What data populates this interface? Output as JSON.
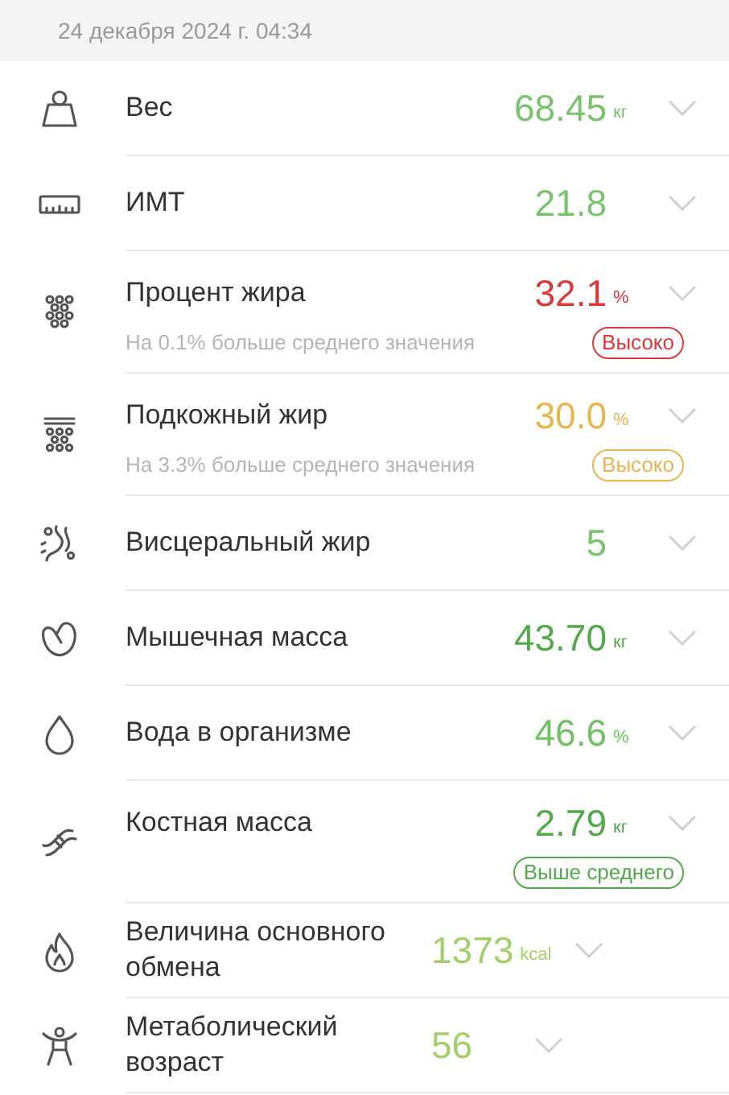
{
  "date": "24 декабря 2024 г. 04:34",
  "metrics": [
    {
      "label": "Вес",
      "value": "68.45",
      "unit": "кг",
      "color": "#79c46a"
    },
    {
      "label": "ИМТ",
      "value": "21.8",
      "color": "#79c46a"
    },
    {
      "label": "Процент жира",
      "value": "32.1",
      "unit": "%",
      "color": "#d9393b",
      "note": "На 0.1% больше среднего значения",
      "badge": "Высоко"
    },
    {
      "label": "Подкожный жир",
      "value": "30.0",
      "unit": "%",
      "color": "#e6b650",
      "note": "На 3.3% больше среднего значения",
      "badge": "Высоко"
    },
    {
      "label": "Висцеральный жир",
      "value": "5",
      "color": "#79c46a"
    },
    {
      "label": "Мышечная масса",
      "value": "43.70",
      "unit": "кг",
      "color": "#52a94a"
    },
    {
      "label": "Вода в организме",
      "value": "46.6",
      "unit": "%",
      "color": "#70c264"
    },
    {
      "label": "Костная масса",
      "value": "2.79",
      "unit": "кг",
      "color": "#52a94a",
      "badge": "Выше среднего"
    },
    {
      "label": "Величина основного обмена",
      "value": "1373",
      "unit": "kcal",
      "color": "#a3cf6a"
    },
    {
      "label": "Метаболический возраст",
      "value": "56",
      "color": "#a3cf6a"
    }
  ]
}
